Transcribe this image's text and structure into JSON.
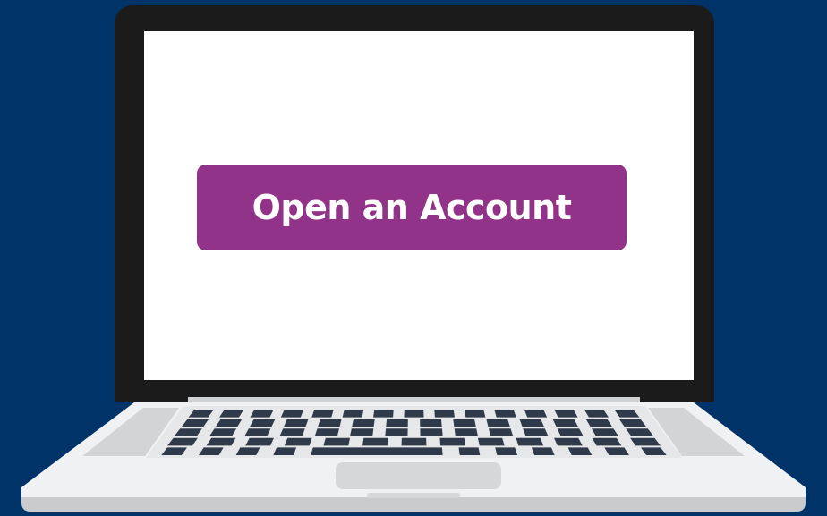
{
  "page": {
    "background_color": "#003469"
  },
  "laptop": {
    "bezel_color": "#1b1b1b",
    "screen_color": "#ffffff",
    "deck_color": "#f0f1f2",
    "key_color": "#2f3a4a",
    "trackpad_color": "#d6d7d8"
  },
  "screen": {
    "cta_button": {
      "label": "Open an Account",
      "color": "#913388",
      "text_color": "#ffffff"
    }
  }
}
